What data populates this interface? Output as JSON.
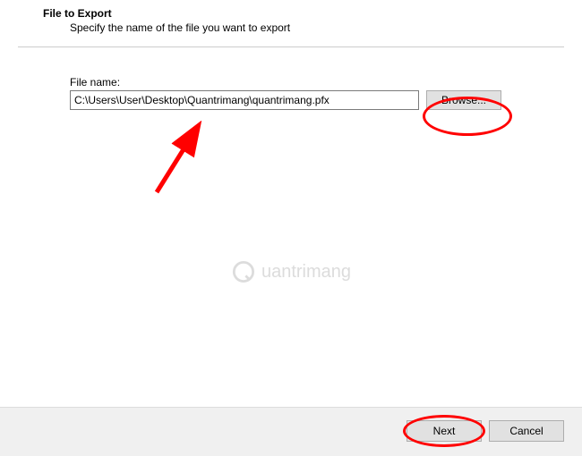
{
  "header": {
    "title": "File to Export",
    "subtitle": "Specify the name of the file you want to export"
  },
  "form": {
    "filename_label": "File name:",
    "filename_value": "C:\\Users\\User\\Desktop\\Quantrimang\\quantrimang.pfx",
    "browse_label": "Browse..."
  },
  "footer": {
    "next_label": "Next",
    "cancel_label": "Cancel"
  },
  "watermark": {
    "text": "uantrimang"
  }
}
